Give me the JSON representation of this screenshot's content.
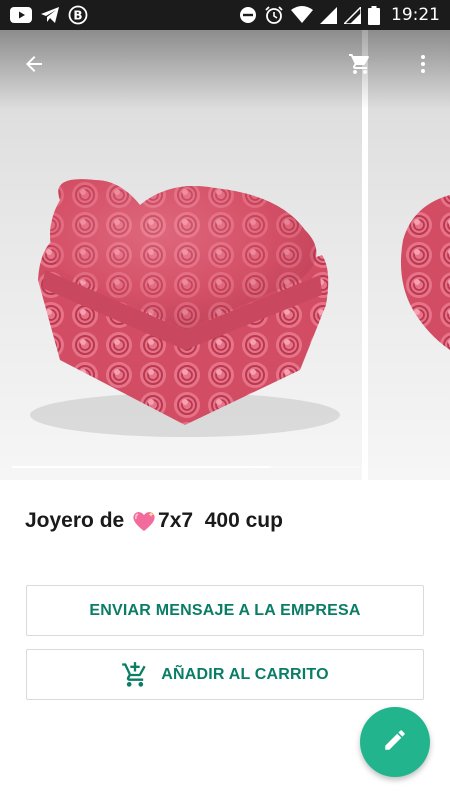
{
  "status_bar": {
    "time": "19:21",
    "left_icons": [
      "youtube-icon",
      "telegram-icon",
      "b-circle-icon"
    ],
    "right_icons": [
      "do-not-disturb-icon",
      "alarm-icon",
      "wifi-icon",
      "signal-icon",
      "signal-icon",
      "battery-icon"
    ]
  },
  "toolbar": {
    "back_icon": "arrow-back-icon",
    "cart_icon": "shopping-cart-icon",
    "more_icon": "more-vert-icon"
  },
  "carousel": {
    "image_count_visible": 2,
    "progress": 0.74
  },
  "product": {
    "title_prefix": "Joyero de ",
    "title_emoji": "sparkling-heart-icon",
    "title_suffix": "7x7  400 cup"
  },
  "actions": {
    "message_label": "ENVIAR MENSAJE A LA EMPRESA",
    "cart_label": "AÑADIR AL CARRITO",
    "cart_icon": "add-shopping-cart-icon"
  },
  "fab": {
    "icon": "edit-pencil-icon"
  },
  "colors": {
    "accent": "#0a7d66",
    "fab": "#22b58d",
    "status_bar": "#1b1b1b"
  }
}
